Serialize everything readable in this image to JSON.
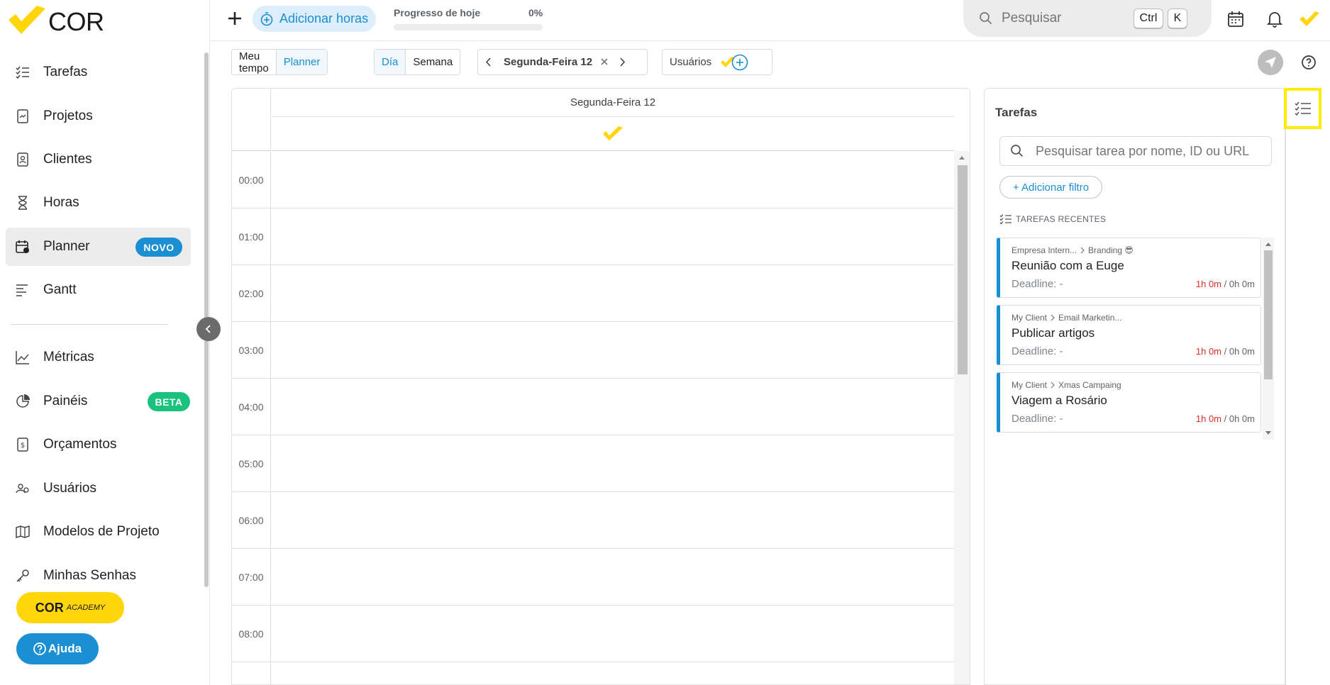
{
  "brand": {
    "name": "COR",
    "accent": "#FFD60A",
    "primary": "#1A8FD1"
  },
  "sidebar": {
    "items": [
      {
        "label": "Tarefas",
        "icon": "task-list-icon"
      },
      {
        "label": "Projetos",
        "icon": "project-doc-icon"
      },
      {
        "label": "Clientes",
        "icon": "client-card-icon"
      },
      {
        "label": "Horas",
        "icon": "hourglass-icon"
      },
      {
        "label": "Planner",
        "icon": "planner-calendar-icon",
        "badge": "NOVO",
        "active": true
      },
      {
        "label": "Gantt",
        "icon": "gantt-bars-icon"
      },
      {
        "label": "Métricas",
        "icon": "area-chart-icon"
      },
      {
        "label": "Painéis",
        "icon": "pie-chart-icon",
        "badge": "BETA"
      },
      {
        "label": "Orçamentos",
        "icon": "budget-doc-icon"
      },
      {
        "label": "Usuários",
        "icon": "users-icon"
      },
      {
        "label": "Modelos de Projeto",
        "icon": "map-template-icon"
      },
      {
        "label": "Minhas Senhas",
        "icon": "key-icon"
      }
    ],
    "academy": {
      "brand": "COR",
      "tag": "ACADEMY"
    },
    "help_label": "Ajuda"
  },
  "topbar": {
    "add_hours_label": "Adicionar horas",
    "progress_label": "Progresso de hoje",
    "progress_value": "0%",
    "progress_fraction": 0,
    "search_placeholder": "Pesquisar",
    "shortcut_keys": [
      "Ctrl",
      "K"
    ]
  },
  "toolbar": {
    "view_tabs": [
      "Meu tempo",
      "Planner"
    ],
    "active_view": "Planner",
    "range_tabs": [
      "Día",
      "Semana"
    ],
    "active_range": "Día",
    "date_label": "Segunda-Feira 12",
    "users_label": "Usuários"
  },
  "calendar": {
    "day_header": "Segunda-Feira 12",
    "hours": [
      "00:00",
      "01:00",
      "02:00",
      "03:00",
      "04:00",
      "05:00",
      "06:00",
      "07:00",
      "08:00"
    ]
  },
  "tasks_panel": {
    "title": "Tarefas",
    "search_placeholder": "Pesquisar tarea por nome, ID ou URL",
    "filter_label": "+ Adicionar filtro",
    "recent_label": "TAREFAS RECENTES",
    "deadline_label": "Deadline: -",
    "tasks": [
      {
        "client": "Empresa Intern...",
        "project": "Branding 😎",
        "name": "Reunião com a Euge",
        "logged": "1h 0m",
        "estimated": "0h 0m"
      },
      {
        "client": "My Client",
        "project": "Email Marketin...",
        "name": "Publicar artigos",
        "logged": "1h 0m",
        "estimated": "0h 0m"
      },
      {
        "client": "My Client",
        "project": "Xmas Campaing",
        "name": "Viagem a Rosário",
        "logged": "1h 0m",
        "estimated": "0h 0m"
      }
    ]
  }
}
